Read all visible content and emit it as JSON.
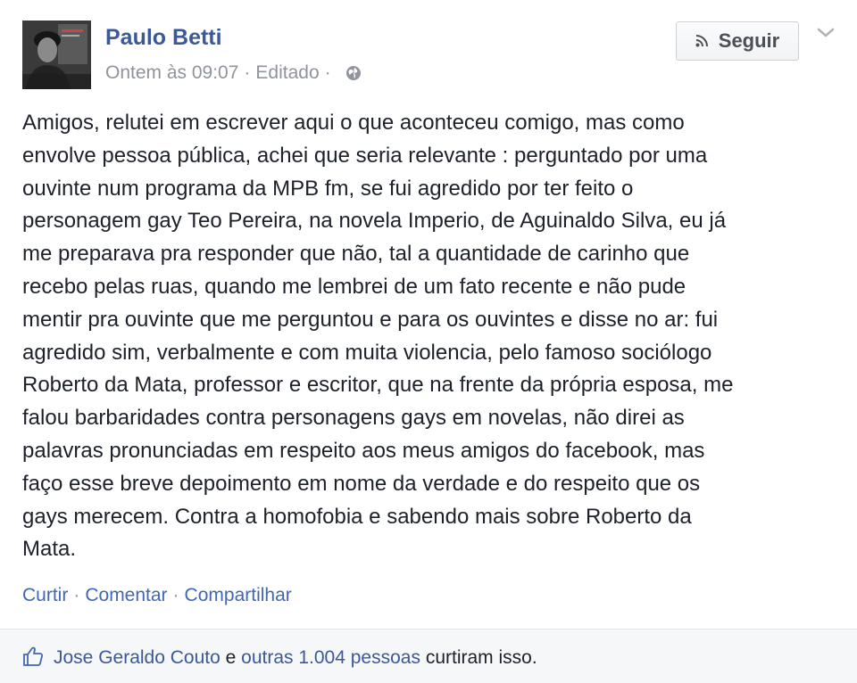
{
  "post": {
    "author": "Paulo Betti",
    "timestamp": "Ontem às 09:07",
    "edited": "Editado",
    "separator": "·",
    "privacy_icon": "globe-icon",
    "follow_label": "Seguir",
    "follow_icon": "rss-icon",
    "menu_icon": "chevron-down-icon",
    "body": "Amigos, relutei em escrever aqui o que aconteceu comigo, mas como\nenvolve pessoa pública, achei que seria relevante : perguntado por uma\nouvinte num programa da MPB fm, se fui agredido por ter feito o\npersonagem gay Teo Pereira, na novela Imperio, de Aguinaldo Silva, eu já\nme preparava pra responder que não, tal a quantidade de carinho que\nrecebo pelas ruas, quando me lembrei de um fato recente e não pude\nmentir pra ouvinte que me perguntou e para os ouvintes e disse no ar: fui\nagredido sim, verbalmente e com muita violencia, pelo famoso sociólogo\nRoberto da Mata, professor e escritor, que na frente da própria esposa, me\nfalou barbaridades contra personagens gays em novelas, não direi as\npalavras pronunciadas em respeito aos meus amigos do facebook, mas\nfaço esse breve depoimento em nome da verdade e do respeito que os\ngays merecem. Contra a homofobia e sabendo mais sobre Roberto da\nMata."
  },
  "actions": {
    "like": "Curtir",
    "comment": "Comentar",
    "share": "Compartilhar",
    "separator": "·"
  },
  "likes": {
    "icon": "thumbs-up-icon",
    "first_name": "Jose Geraldo Couto",
    "conjunction": "e",
    "others": "outras 1.004 pessoas",
    "suffix": "curtiram isso."
  },
  "colors": {
    "link": "#3b5998",
    "action_link": "#4267b2",
    "muted": "#90949c",
    "text": "#1d2129",
    "footer_bg": "#f6f7f9"
  }
}
